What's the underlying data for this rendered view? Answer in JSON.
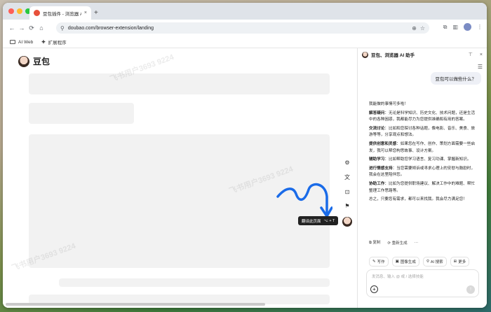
{
  "browser": {
    "tab_title": "豆包插件 - 浏览器 AI 助手",
    "tab_close": "×",
    "new_tab": "+",
    "url": "doubao.com/browser-extension/landing",
    "nav": {
      "back": "←",
      "forward": "→",
      "reload": "⟳",
      "home": "⌂"
    },
    "bookmarks": [
      {
        "label": "AI Web"
      },
      {
        "label": "扩展程序"
      }
    ]
  },
  "page": {
    "brand": "豆包",
    "tooltip": {
      "label": "翻译此页面",
      "shortcut": "⌥ + T"
    },
    "watermark": "飞书用户3693 9224"
  },
  "panel": {
    "title": "豆包、浏览器 AI 助手",
    "user_message": "豆包可以做些什么？",
    "answer": {
      "intro": "我能做的事情可多啦！",
      "items": [
        {
          "heading": "解答疑问",
          "text": "：无论是科学知识、历史文化、技术问题，还是生活中的各种困惑，我都能尽力为您提供准确和有用的答案。"
        },
        {
          "heading": "交流讨论",
          "text": "：比如和您探讨各种话题，像电影、音乐、美食、旅游等等，分享观点和想法。"
        },
        {
          "heading": "提供创意和灵感",
          "text": "：如果您在写作、创作、策划方面需要一些启发，我可以帮您构思故事、设计方案。"
        },
        {
          "heading": "辅助学习",
          "text": "：比如帮助您学习语言、复习功课、掌握新知识。"
        },
        {
          "heading": "进行情感支持",
          "text": "：当您需要倾诉或寻求心理上的安慰与鼓励时，我会在这里陪伴您。"
        },
        {
          "heading": "协助工作",
          "text": "：比如为您提供职场建议、解决工作中的难题、帮忙整理工作思路等。"
        }
      ],
      "outro": "总之，只要您有需求，都可以来找我。我会尽力满足您！"
    },
    "actions": {
      "copy": "复制",
      "regenerate": "重新生成",
      "more": "···"
    },
    "chips": [
      {
        "label": "写作"
      },
      {
        "label": "图像生成"
      },
      {
        "label": "AI 搜索"
      },
      {
        "label": "更多"
      }
    ],
    "input_placeholder": "发消息、输入 @ 或 / 选择技能"
  },
  "colors": {
    "accent_arrow": "#1a6be8",
    "page_bg": "#ffffff",
    "skeleton": "#f2f2f2"
  }
}
